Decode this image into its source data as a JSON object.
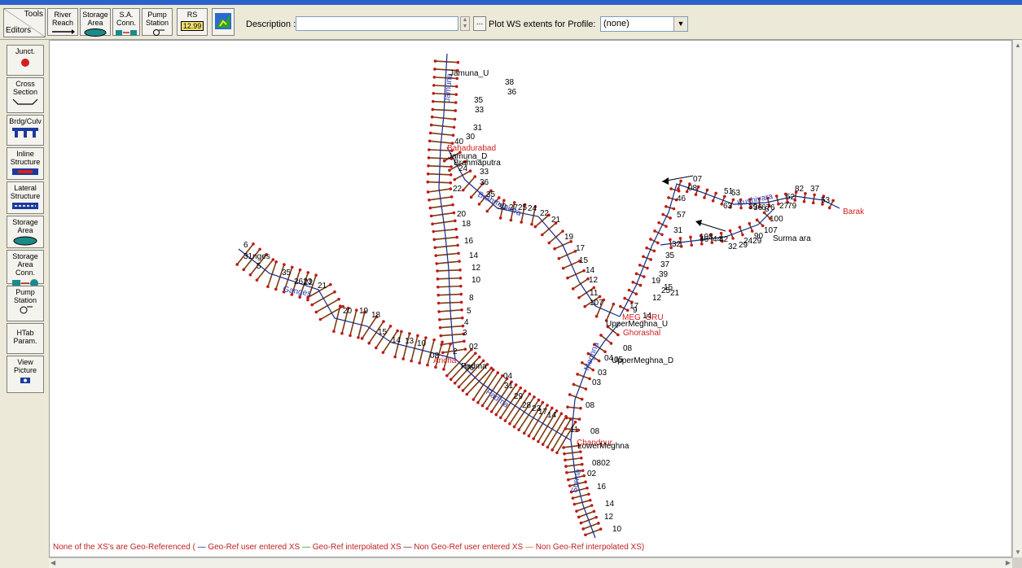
{
  "toolbar": {
    "corner_tools": "Tools",
    "corner_editors": "Editors",
    "buttons": [
      {
        "line1": "River",
        "line2": "Reach"
      },
      {
        "line1": "Storage",
        "line2": "Area"
      },
      {
        "line1": "S.A.",
        "line2": "Conn."
      },
      {
        "line1": "Pump",
        "line2": "Station"
      },
      {
        "line1": "RS",
        "line2": "12.99"
      }
    ],
    "description_label": "Description :",
    "description_value": "",
    "browse_label": "...",
    "plot_ws_label": "Plot WS extents for Profile:",
    "profile_value": "(none)"
  },
  "sidebar": {
    "items": [
      {
        "label": "Junct."
      },
      {
        "label": "Cross Section"
      },
      {
        "label": "Brdg/Culv"
      },
      {
        "label": "Inline Structure"
      },
      {
        "label": "Lateral Structure"
      },
      {
        "label": "Storage Area"
      },
      {
        "label": "Storage Area Conn."
      },
      {
        "label": "Pump Station"
      },
      {
        "label": "HTab Param."
      },
      {
        "label": "View Picture"
      }
    ]
  },
  "map": {
    "junctions": [
      "Bahadurabad",
      "Aricha",
      "Chandpur",
      "MEG_GRU",
      "Ghorashal",
      "Barak"
    ],
    "reach_labels": [
      "Jamuna",
      "Brahmaputra",
      "Ganges",
      "Padma",
      "Meghna",
      "Surma",
      "Kushiyara"
    ],
    "black_labels": [
      "Jamuna_U",
      "Jamuna_D",
      "Brahmaputra",
      "31nges",
      "Padma",
      "UpperMeghna_U",
      "UpperMeghna_D",
      "LowerMeghna",
      "Surma ara",
      "38",
      "36",
      "35",
      "33",
      "31",
      "30",
      "40",
      "24",
      "22",
      "20",
      "18",
      "16",
      "14",
      "12",
      "10",
      "8",
      "5",
      "4",
      "3",
      "2",
      "02",
      "33",
      "36",
      "35",
      "30",
      "27",
      "25",
      "24",
      "22",
      "21",
      "19",
      "17",
      "15",
      "14",
      "12",
      "11",
      "107",
      "6",
      "5",
      "35",
      "2623",
      "22",
      "21",
      "20",
      "19",
      "18",
      "15",
      "14",
      "13",
      "10",
      "08",
      "06",
      "04",
      "31",
      "29",
      "28",
      "23",
      "17",
      "14",
      "11",
      "08",
      "0802",
      "02",
      "16",
      "14",
      "12",
      "10",
      "08",
      "03",
      "03",
      "04",
      "05",
      "08",
      "07",
      "08",
      "51",
      "53",
      "46",
      "57",
      "63",
      "39",
      "36",
      "676",
      "8",
      "27",
      "79",
      "82",
      "37",
      "52",
      "53",
      "100",
      "107",
      "90",
      "108",
      "46",
      "44",
      "42",
      "32",
      "29",
      "2429",
      "31",
      "32",
      "35",
      "37",
      "39",
      "25",
      "21",
      "19",
      "15",
      "12",
      "17",
      "14",
      "9",
      "10",
      "4",
      "7",
      "5"
    ]
  },
  "legend": {
    "part1": "None of the XS's are Geo-Referenced ( ",
    "geo_user": "Geo-Ref user entered XS",
    "geo_interp": "Geo-Ref interpolated XS",
    "non_geo_user": "Non Geo-Ref user entered XS",
    "non_geo_interp": "Non Geo-Ref interpolated XS)"
  },
  "colors": {
    "junction": "#d02020",
    "reach_line": "#1a2a8a",
    "xs_line": "#7a3a10",
    "xs_dot": "#c01818",
    "geo_user": "#0a2a6a",
    "geo_interp": "#1a9a1a",
    "non_geo_user": "#7a1010",
    "non_geo_interp": "#e06010"
  }
}
